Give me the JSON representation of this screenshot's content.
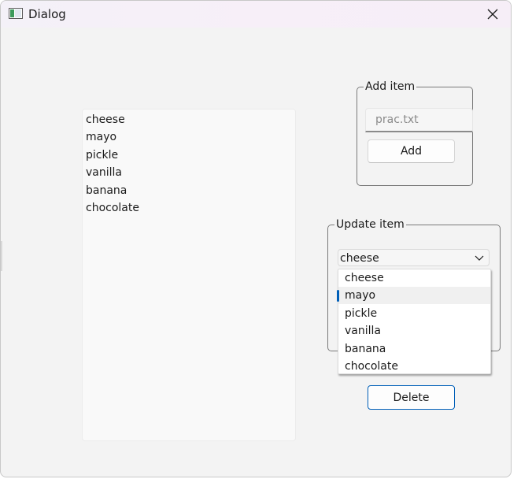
{
  "window": {
    "title": "Dialog"
  },
  "list": {
    "items": [
      "cheese",
      "mayo",
      "pickle",
      "vanilla",
      "banana",
      "chocolate"
    ]
  },
  "add_group": {
    "title": "Add item",
    "input_placeholder": "prac.txt",
    "input_value": "",
    "add_label": "Add"
  },
  "update_group": {
    "title": "Update item",
    "combo_selected": "cheese",
    "combo_options": [
      "cheese",
      "mayo",
      "pickle",
      "vanilla",
      "banana",
      "chocolate"
    ],
    "delete_label": "Delete"
  },
  "icons": {
    "window": "window-icon",
    "close": "close-icon",
    "dropdown": "chevron-down-icon"
  },
  "colors": {
    "accent": "#005fb8",
    "titlebar": "#f6eef7",
    "window_bg": "#f3f3f3"
  }
}
